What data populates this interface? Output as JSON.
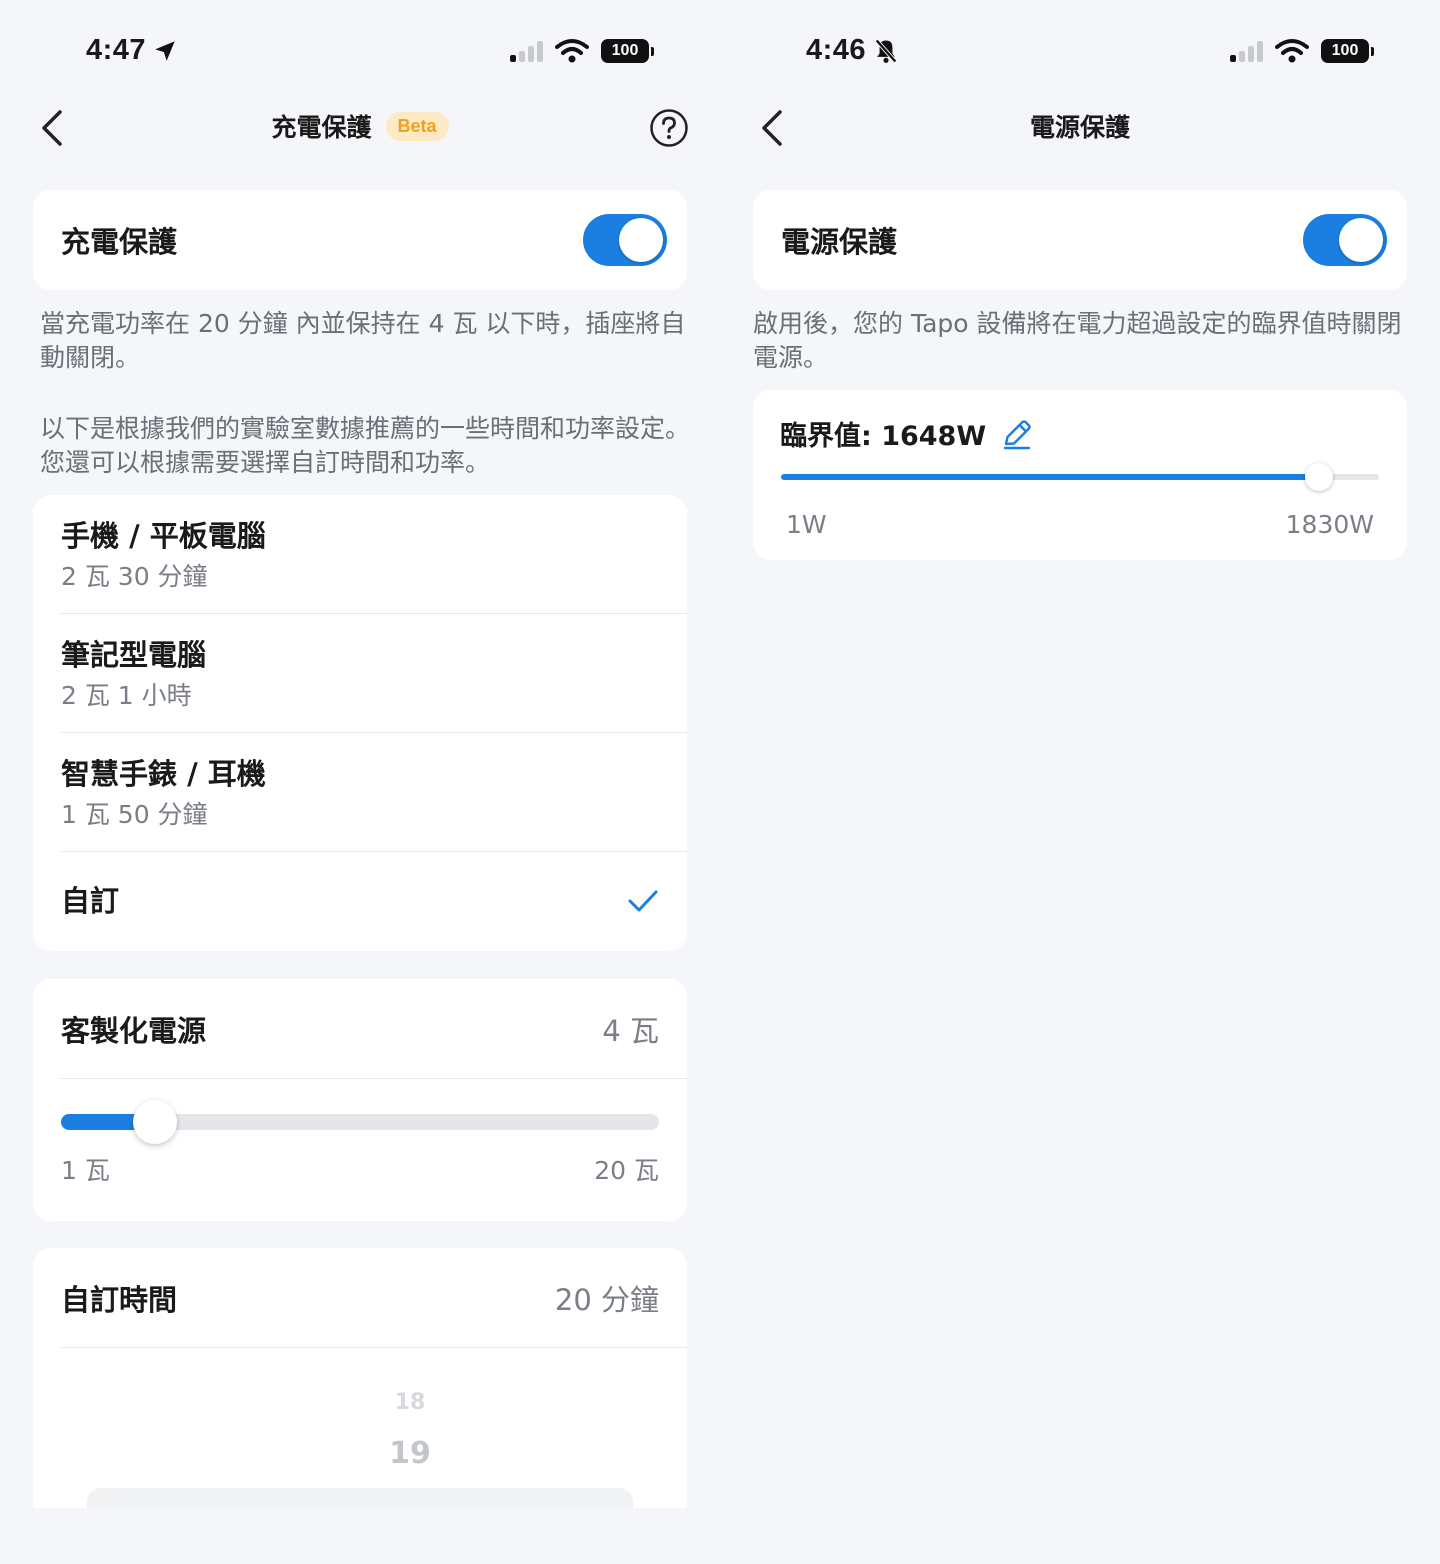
{
  "left": {
    "status": {
      "time": "4:47",
      "battery": "100"
    },
    "nav": {
      "title": "充電保護",
      "badge": "Beta"
    },
    "toggle_card": {
      "label": "充電保護",
      "enabled": true
    },
    "description_1": "當充電功率在 20 分鐘 內並保持在 4 瓦 以下時，插座將自動關閉。",
    "description_2": "以下是根據我們的實驗室數據推薦的一些時間和功率設定。您還可以根據需要選擇自訂時間和功率。",
    "presets": [
      {
        "title": "手機 / 平板電腦",
        "subtitle": "2 瓦 30 分鐘"
      },
      {
        "title": "筆記型電腦",
        "subtitle": "2 瓦 1 小時"
      },
      {
        "title": "智慧手錶 / 耳機",
        "subtitle": "1 瓦 50 分鐘"
      }
    ],
    "custom_option": {
      "label": "自訂",
      "selected": true
    },
    "power_card": {
      "label": "客製化電源",
      "value": "4 瓦",
      "slider": {
        "min_label": "1 瓦",
        "max_label": "20 瓦",
        "min": 1,
        "max": 20,
        "value": 4
      }
    },
    "time_card": {
      "label": "自訂時間",
      "value": "20 分鐘",
      "picker_values": [
        "18",
        "19"
      ]
    }
  },
  "right": {
    "status": {
      "time": "4:46",
      "battery": "100"
    },
    "nav": {
      "title": "電源保護"
    },
    "toggle_card": {
      "label": "電源保護",
      "enabled": true
    },
    "description": "啟用後，您的 Tapo 設備將在電力超過設定的臨界值時關閉電源。",
    "threshold_card": {
      "label": "臨界值: 1648W",
      "slider": {
        "min_label": "1W",
        "max_label": "1830W",
        "min": 1,
        "max": 1830,
        "value": 1648
      }
    }
  },
  "colors": {
    "accent": "#1a7fe0",
    "background": "#f4f6fa",
    "badge_bg": "#fde9c4",
    "badge_text": "#f0a020"
  }
}
